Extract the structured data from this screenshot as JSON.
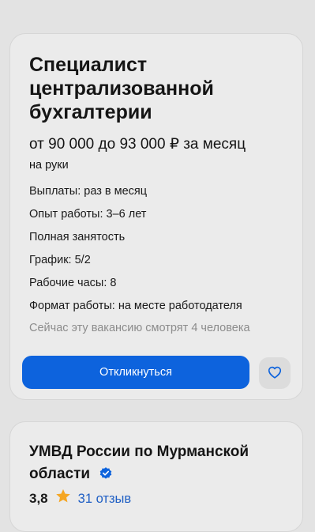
{
  "vacancy": {
    "title": "Специалист централизованной бухгалтерии",
    "salary": "от 90 000 до 93 000 ₽ за месяц",
    "salary_note": "на руки",
    "details": [
      "Выплаты: раз в месяц",
      "Опыт работы: 3–6 лет",
      "Полная занятость",
      "График: 5/2",
      "Рабочие часы: 8",
      "Формат работы: на месте работодателя"
    ],
    "viewers": "Сейчас эту вакансию смотрят 4 человека",
    "apply_label": "Откликнуться",
    "favorite_icon": "heart-icon"
  },
  "company": {
    "name": "УМВД России по Мурманской области",
    "verified_icon": "verified-check-icon",
    "rating": "3,8",
    "star_icon": "star-icon",
    "reviews": "31 отзыв"
  },
  "colors": {
    "accent": "#0d63dd",
    "star": "#f5a623",
    "link": "#1f5fc4"
  }
}
